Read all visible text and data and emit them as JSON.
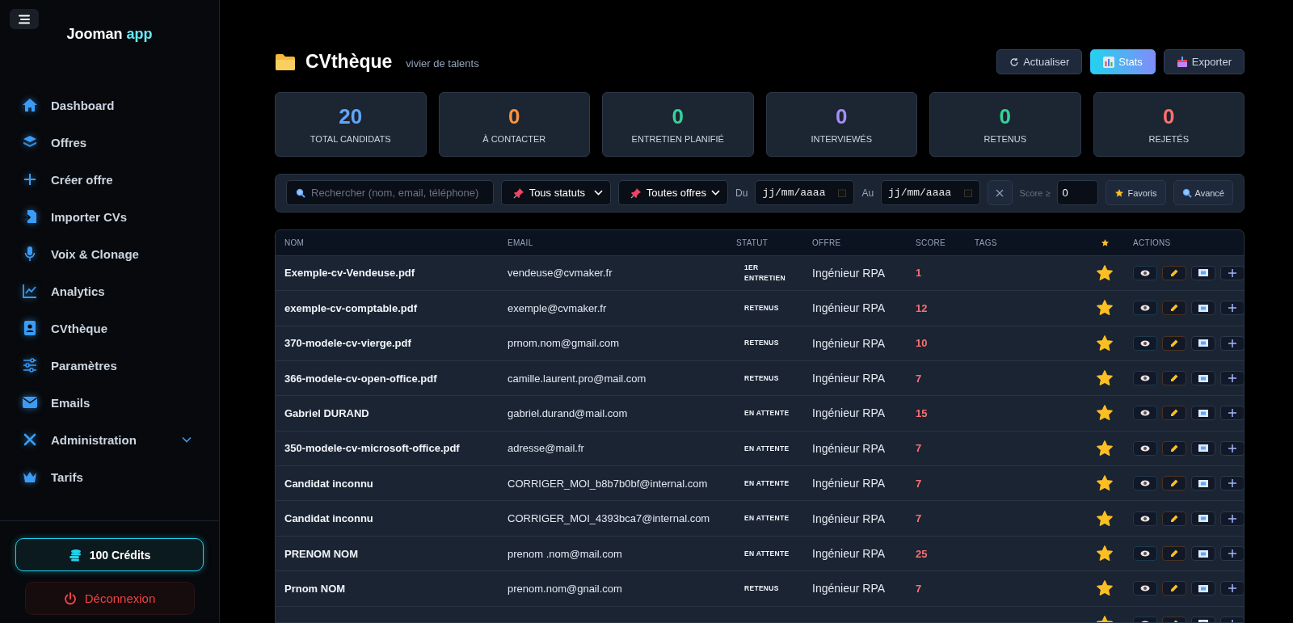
{
  "sidebar": {
    "brand": {
      "name": "Jooman",
      "suffix": "app"
    },
    "items": [
      {
        "label": "Dashboard"
      },
      {
        "label": "Offres"
      },
      {
        "label": "Créer offre"
      },
      {
        "label": "Importer CVs"
      },
      {
        "label": "Voix & Clonage"
      },
      {
        "label": "Analytics"
      },
      {
        "label": "CVthèque"
      },
      {
        "label": "Paramètres"
      },
      {
        "label": "Emails"
      },
      {
        "label": "Administration",
        "expanded": false
      },
      {
        "label": "Tarifs"
      }
    ],
    "credits": "100 Crédits",
    "logout": "Déconnexion"
  },
  "header": {
    "title": "CVthèque",
    "subtitle": "vivier de talents",
    "buttons": [
      {
        "label": "Actualiser",
        "kind": "refresh"
      },
      {
        "label": "Stats",
        "kind": "stats"
      },
      {
        "label": "Exporter",
        "kind": "export"
      }
    ]
  },
  "stats": [
    {
      "value": "20",
      "label": "TOTAL CANDIDATS",
      "color": "#60a5fa"
    },
    {
      "value": "0",
      "label": "À CONTACTER",
      "color": "#fb923c"
    },
    {
      "value": "0",
      "label": "ENTRETIEN PLANIFIÉ",
      "color": "#34d399"
    },
    {
      "value": "0",
      "label": "INTERVIEWÉS",
      "color": "#a78bfa"
    },
    {
      "value": "0",
      "label": "RETENUS",
      "color": "#34d399"
    },
    {
      "value": "0",
      "label": "REJETÉS",
      "color": "#f87171"
    }
  ],
  "filters": {
    "search": {
      "placeholder": "Rechercher (nom, email, téléphone)"
    },
    "status": "Tous statuts",
    "offer": "Toutes offres",
    "from_label": "Du",
    "from": {
      "placeholder": "jj/mm/aaaa"
    },
    "to_label": "Au",
    "to": {
      "placeholder": "jj/mm/aaaa"
    },
    "score_label": "Score ≥",
    "score": "0",
    "favorites": "Favoris",
    "advanced": "Avancé"
  },
  "table": {
    "columns": [
      "NOM",
      "EMAIL",
      "STATUT",
      "OFFRE",
      "SCORE",
      "TAGS",
      "ACTIONS"
    ],
    "rows": [
      {
        "name": "Exemple-cv-Vendeuse.pdf",
        "email": "vendeuse@cvmaker.fr",
        "status": "1ER ENTRETIEN",
        "offer": "Ingénieur RPA",
        "score": "1",
        "favorite": true
      },
      {
        "name": "exemple-cv-comptable.pdf",
        "email": "exemple@cvmaker.fr",
        "status": "RETENUS",
        "offer": "Ingénieur RPA",
        "score": "12",
        "favorite": true
      },
      {
        "name": "370-modele-cv-vierge.pdf",
        "email": "prnom.nom@gmail.com",
        "status": "RETENUS",
        "offer": "Ingénieur RPA",
        "score": "10",
        "favorite": true
      },
      {
        "name": "366-modele-cv-open-office.pdf",
        "email": "camille.laurent.pro@mail.com",
        "status": "RETENUS",
        "offer": "Ingénieur RPA",
        "score": "7",
        "favorite": true
      },
      {
        "name": "Gabriel DURAND",
        "email": "gabriel.durand@mail.com",
        "status": "EN ATTENTE",
        "offer": "Ingénieur RPA",
        "score": "15",
        "favorite": true
      },
      {
        "name": "350-modele-cv-microsoft-office.pdf",
        "email": "adresse@mail.fr",
        "status": "EN ATTENTE",
        "offer": "Ingénieur RPA",
        "score": "7",
        "favorite": true
      },
      {
        "name": "Candidat inconnu",
        "email": "CORRIGER_MOI_b8b7b0bf@internal.com",
        "status": "EN ATTENTE",
        "offer": "Ingénieur RPA",
        "score": "7",
        "favorite": true
      },
      {
        "name": "Candidat inconnu",
        "email": "CORRIGER_MOI_4393bca7@internal.com",
        "status": "EN ATTENTE",
        "offer": "Ingénieur RPA",
        "score": "7",
        "favorite": true
      },
      {
        "name": "PRENOM NOM",
        "email": "prenom .nom@mail.com",
        "status": "EN ATTENTE",
        "offer": "Ingénieur RPA",
        "score": "25",
        "favorite": true
      },
      {
        "name": "Prnom NOM",
        "email": "prenom.nom@gnail.com",
        "status": "RETENUS",
        "offer": "Ingénieur RPA",
        "score": "7",
        "favorite": true
      },
      {
        "favorite": true
      }
    ]
  }
}
